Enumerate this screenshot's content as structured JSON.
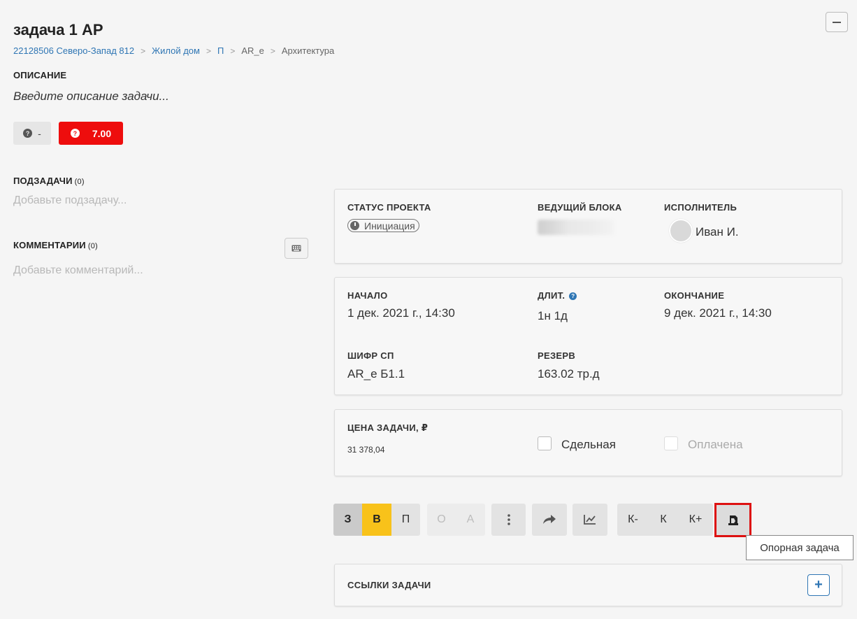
{
  "task": {
    "title": "задача 1 АР",
    "breadcrumbs": [
      "22128506 Северо-Запад 812",
      "Жилой дом",
      "П",
      "AR_e",
      "Архитектура"
    ],
    "description_label": "ОПИСАНИЕ",
    "description_placeholder": "Введите описание задачи...",
    "chip_grey_value": "-",
    "chip_red_value": "7.00",
    "subtasks_label": "ПОДЗАДАЧИ",
    "subtasks_count": "(0)",
    "subtasks_placeholder": "Добавьте подзадачу...",
    "comments_label": "КОММЕНТАРИИ",
    "comments_count": "(0)",
    "comments_placeholder": "Добавьте комментарий..."
  },
  "status_card": {
    "status_label": "СТАТУС ПРОЕКТА",
    "status_value": "Инициация",
    "lead_label": "ВЕДУЩИЙ БЛОКА",
    "executor_label": "ИСПОЛНИТЕЛЬ",
    "executor_name": "Иван И."
  },
  "dates_card": {
    "start_label": "НАЧАЛО",
    "start_value": "1 дек. 2021 г., 14:30",
    "duration_label": "ДЛИТ.",
    "duration_value": "1н 1д",
    "end_label": "ОКОНЧАНИЕ",
    "end_value": "9 дек. 2021 г., 14:30",
    "code_label": "ШИФР СП",
    "code_value": "AR_e Б1.1",
    "reserve_label": "РЕЗЕРВ",
    "reserve_value": "163.02 тр.д"
  },
  "price_card": {
    "price_label": "ЦЕНА ЗАДАЧИ, ₽",
    "price_value": "31 378,04",
    "piecework_label": "Сдельная",
    "paid_label": "Оплачена"
  },
  "toolbar": {
    "z": "З",
    "v": "В",
    "p": "П",
    "o": "О",
    "a": "А",
    "k_minus": "К-",
    "k": "К",
    "k_plus": "К+"
  },
  "tooltip": "Опорная задача",
  "links_card": {
    "label": "ССЫЛКИ ЗАДАЧИ",
    "add_symbol": "+"
  },
  "colors": {
    "accent": "#2f76b4",
    "danger": "#ee0d0d",
    "warning": "#f8c21a",
    "highlight_border": "#dd1111"
  },
  "icons": {
    "collapse": "minus-icon",
    "comments_input": "keyboard-icon",
    "status": "clock-icon",
    "more": "more-vertical-icon",
    "share": "share-arrow-icon",
    "chart": "chart-line-icon",
    "anchor_task": "anchor-task-icon",
    "add_link": "plus-icon"
  }
}
